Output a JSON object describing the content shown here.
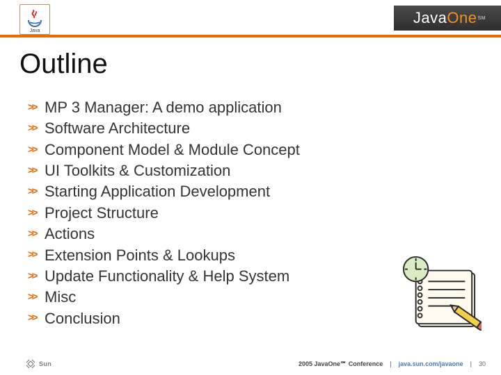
{
  "header": {
    "java_label": "Java",
    "brand_prefix": "Java",
    "brand_highlight": "One",
    "brand_tm": "SM"
  },
  "title": "Outline",
  "bullets": [
    "MP 3 Manager: A demo application",
    "Software Architecture",
    "Component Model & Module Concept",
    "UI Toolkits & Customization",
    "Starting Application Development",
    "Project Structure",
    "Actions",
    "Extension Points & Lookups",
    "Update Functionality & Help System",
    "Misc",
    "Conclusion"
  ],
  "footer": {
    "sun_label": "Sun",
    "conference": "2005 JavaOne℠ Conference",
    "url": "java.sun.com/javaone",
    "separator": "|",
    "page_number": "30"
  }
}
